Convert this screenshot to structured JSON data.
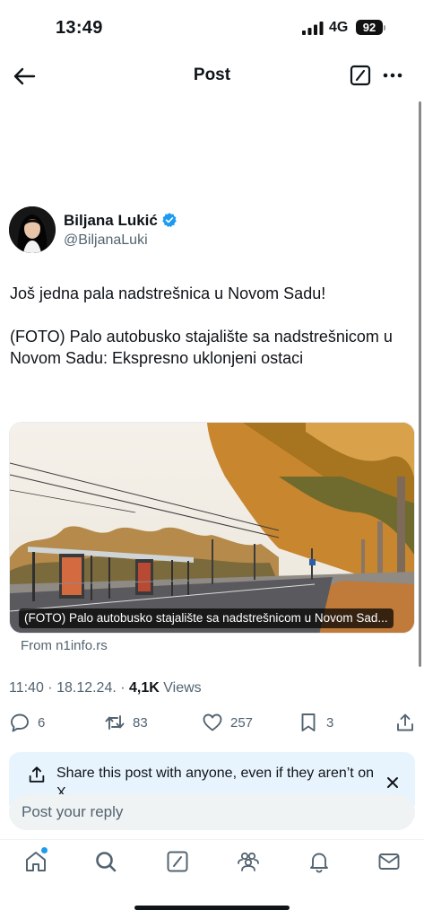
{
  "status_bar": {
    "time": "13:49",
    "network": "4G",
    "battery": "92"
  },
  "header": {
    "title": "Post"
  },
  "author": {
    "name": "Biljana Lukić",
    "handle": "@BiljanaLuki",
    "verified": true
  },
  "tweet": {
    "paragraphs": [
      "Još jedna pala nadstrešnica u Novom Sadu!",
      "(FOTO) Palo autobusko stajalište sa nadstrešnicom u Novom Sadu: Ekspresno uklonjeni ostaci"
    ]
  },
  "link_card": {
    "caption": "(FOTO) Palo autobusko stajalište sa nadstrešnicom u Novom Sad...",
    "source": "From n1info.rs"
  },
  "meta": {
    "time_date": "11:40 · 18.12.24. · ",
    "views_count": "4,1K",
    "views_label": " Views"
  },
  "actions": {
    "replies": "6",
    "reposts": "83",
    "likes": "257",
    "bookmarks": "3"
  },
  "share_banner": {
    "text": "Share this post with anyone, even if they aren’t on X"
  },
  "reply": {
    "placeholder": "Post your reply"
  },
  "tabs": [
    "home-icon",
    "search-icon",
    "compose-icon",
    "communities-icon",
    "notifications-icon",
    "messages-icon"
  ],
  "colors": {
    "accent": "#1d9bf0",
    "text": "#0f1419",
    "secondary": "#536471",
    "banner": "#e8f4fd"
  }
}
